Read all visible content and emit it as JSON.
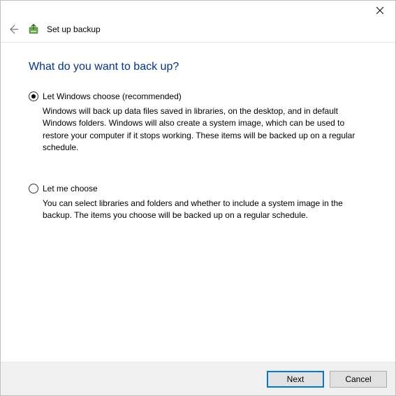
{
  "header": {
    "title": "Set up backup"
  },
  "page": {
    "heading": "What do you want to back up?"
  },
  "options": {
    "opt1": {
      "label": "Let Windows choose (recommended)",
      "description": "Windows will back up data files saved in libraries, on the desktop, and in default Windows folders. Windows will also create a system image, which can be used to restore your computer if it stops working. These items will be backed up on a regular schedule.",
      "selected": true
    },
    "opt2": {
      "label": "Let me choose",
      "description": "You can select libraries and folders and whether to include a system image in the backup. The items you choose will be backed up on a regular schedule.",
      "selected": false
    }
  },
  "footer": {
    "next": "Next",
    "cancel": "Cancel"
  }
}
